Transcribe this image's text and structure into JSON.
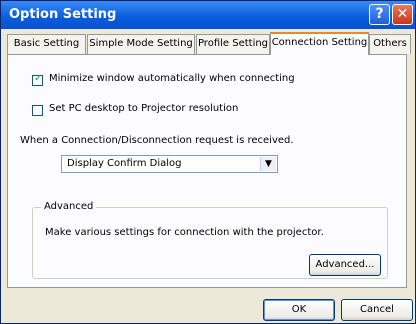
{
  "window": {
    "title": "Option Setting",
    "help_label": "?",
    "close_label": "✕"
  },
  "tabs": [
    {
      "label": "Basic Setting",
      "active": false
    },
    {
      "label": "Simple Mode Setting",
      "active": false
    },
    {
      "label": "Profile Setting",
      "active": false
    },
    {
      "label": "Connection Setting",
      "active": true
    },
    {
      "label": "Others",
      "active": false
    }
  ],
  "connection": {
    "minimize_label": "Minimize window automatically when connecting",
    "minimize_checked": true,
    "set_desktop_label": "Set PC desktop to Projector resolution",
    "set_desktop_checked": false,
    "request_label": "When a Connection/Disconnection request is received.",
    "request_value": "Display Confirm Dialog"
  },
  "advanced": {
    "legend": "Advanced",
    "description": "Make various settings for connection with the projector.",
    "button_label": "Advanced..."
  },
  "footer": {
    "ok_label": "OK",
    "cancel_label": "Cancel"
  },
  "icons": {
    "checkmark": "✓",
    "dropdown": "▼"
  }
}
